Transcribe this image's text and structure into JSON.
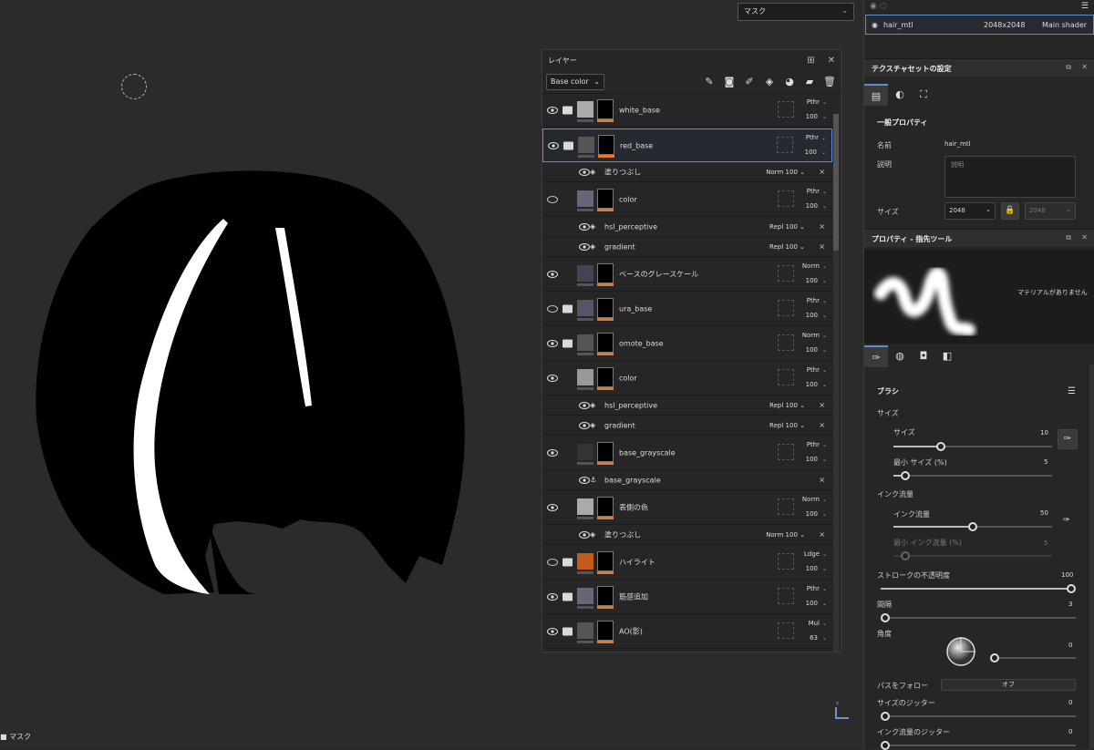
{
  "viewport": {
    "channel_label": "マスク",
    "bottom_label": "マスク",
    "axis_label": "Y"
  },
  "layers_panel": {
    "title": "レイヤー",
    "channel": "Base color",
    "layers": [
      {
        "name": "white_base",
        "blend": "Pthr",
        "opacity": "100",
        "visible": true,
        "folder": true
      },
      {
        "name": "red_base",
        "blend": "Pthr",
        "opacity": "100",
        "visible": true,
        "folder": true,
        "selected": true
      },
      {
        "name": "塗りつぶし",
        "blend": "Norm",
        "opacity": "100",
        "sub": true
      },
      {
        "name": "color",
        "blend": "Pthr",
        "opacity": "100",
        "visible": false
      },
      {
        "name": "hsl_perceptive",
        "blend": "Repl",
        "opacity": "100",
        "sub": true
      },
      {
        "name": "gradient",
        "blend": "Repl",
        "opacity": "100",
        "sub": true
      },
      {
        "name": "ベースのグレースケール",
        "blend": "Norm",
        "opacity": "100",
        "visible": true
      },
      {
        "name": "ura_base",
        "blend": "Pthr",
        "opacity": "100",
        "visible": false,
        "folder": true
      },
      {
        "name": "omote_base",
        "blend": "Norm",
        "opacity": "100",
        "visible": true,
        "folder": true
      },
      {
        "name": "color",
        "blend": "Pthr",
        "opacity": "100",
        "visible": true
      },
      {
        "name": "hsl_perceptive",
        "blend": "Repl",
        "opacity": "100",
        "sub": true
      },
      {
        "name": "gradient",
        "blend": "Repl",
        "opacity": "100",
        "sub": true
      },
      {
        "name": "base_grayscale",
        "blend": "Pthr",
        "opacity": "100",
        "visible": true
      },
      {
        "name": "base_grayscale",
        "sub": true,
        "anchor": true
      },
      {
        "name": "表側の色",
        "blend": "Norm",
        "opacity": "100",
        "visible": true
      },
      {
        "name": "塗りつぶし",
        "blend": "Norm",
        "opacity": "100",
        "sub": true
      },
      {
        "name": "ハイライト",
        "blend": "Ldge",
        "opacity": "100",
        "visible": false,
        "folder": true
      },
      {
        "name": "筋感追加",
        "blend": "Pthr",
        "opacity": "100",
        "visible": true,
        "folder": true
      },
      {
        "name": "AO(影)",
        "blend": "Mul",
        "opacity": "63",
        "visible": true,
        "folder": true
      },
      {
        "name": "",
        "blend": "Mul",
        "opacity": "",
        "visible": true
      }
    ]
  },
  "texture_set": {
    "name": "hair_mtl",
    "resolution": "2048x2048",
    "shader": "Main shader"
  },
  "texset_settings": {
    "title": "テクスチャセットの設定",
    "group_title": "一般プロパティ",
    "name_label": "名前",
    "name_value": "hair_mtl",
    "desc_label": "説明",
    "desc_placeholder": "説明",
    "size_label": "サイズ",
    "size_value": "2048",
    "size_value2": "2048"
  },
  "brush_props": {
    "title": "プロパティ - 指先ツール",
    "no_material": "マテリアルがありません",
    "brush_label": "ブラシ",
    "size_group": "サイズ",
    "size_label": "サイズ",
    "size_value": "10",
    "size_fraction": 0.3,
    "min_size_label": "最小 サイズ (%)",
    "min_size_value": "5",
    "flow_group": "インク流量",
    "flow_label": "インク流量",
    "flow_value": "50",
    "flow_fraction": 0.5,
    "min_flow_label": "最小 インク流量 (%)",
    "min_flow_value": "5",
    "opacity_label": "ストロークの不透明度",
    "opacity_value": "100",
    "spacing_label": "間隔",
    "spacing_value": "3",
    "angle_label": "角度",
    "angle_value": "0",
    "follow_path_label": "パスをフォロー",
    "follow_path_value": "オフ",
    "size_jitter_label": "サイズのジッター",
    "size_jitter_value": "0",
    "flow_jitter_label": "インク流量のジッター",
    "flow_jitter_value": "0"
  }
}
